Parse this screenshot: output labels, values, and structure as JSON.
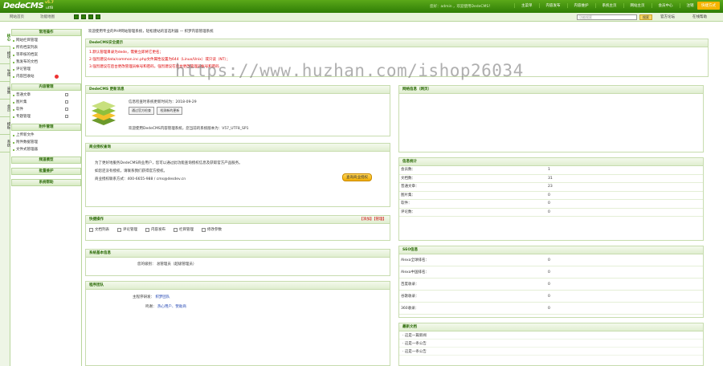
{
  "header": {
    "logo_text": "DedeCMS",
    "logo_version": "v5.7",
    "logo_sub": "utf8",
    "user_info": "您好：admin ，欢迎使用DedeCMS！",
    "nav": [
      "主菜单",
      "内容发布",
      "内容维护",
      "系统主页",
      "网站主页",
      "会员中心",
      "注销"
    ],
    "quick_button": "快捷方式"
  },
  "subbar": {
    "home_link": "网站首页",
    "map_link": "功能地图",
    "search_placeholder": "功能搜索",
    "search_button": "搜索",
    "official_forum": "官方论坛",
    "online_help": "在线帮助"
  },
  "vtabs": [
    "核心",
    "模块",
    "生成",
    "采集",
    "会员",
    "模板",
    "系统"
  ],
  "sidebar": {
    "sections": [
      {
        "title": "常用操作",
        "items": [
          "网站栏目管理",
          "所有档案列表",
          "等审核的档案",
          "我发布的文档",
          "评论管理",
          "内容回收站"
        ]
      },
      {
        "title": "内容管理",
        "items": [
          "普通文章",
          "图片集",
          "软件",
          "专题管理"
        ]
      },
      {
        "title": "附件管理",
        "items": [
          "上传新文件",
          "附件数据管理",
          "文件式管理器"
        ]
      },
      {
        "title": "频道模型",
        "items": []
      },
      {
        "title": "批量维护",
        "items": []
      },
      {
        "title": "系统帮助",
        "items": []
      }
    ]
  },
  "welcome": "欢迎使用专业的PHP网站管理系统，轻松建站的首选利器 — 织梦内容管理系统",
  "security": {
    "title": "DedeCMS安全提示",
    "lines": [
      "1.默认管理目录为dede，需要立即将它更名；",
      "2.强烈建议data/common.inc.php文件属性设置为644（Linux/Unix）或只读（NT）；",
      "3.强烈建议在后台更改管理员帐号和密码，强烈建议在后台更改管理员帐号和密码"
    ]
  },
  "version_panel": {
    "title": "DedeCMS 更新消息",
    "latest_text": "信息检查时系统更新时间为：2018-09-29",
    "btn_check": "通过官方检查",
    "btn_update": "检测新的更新",
    "version_text": "欢迎使用DedeCMS内容管理系统，您当前的系统版本为：V57_UTF8_SP1"
  },
  "business_panel": {
    "title": "商业授权查询",
    "text1": "为了更好地服务DedeCMS商业用户，您可以通过此功能查询授权信息及获取官方产品服务。",
    "text2": "如您还没有授权，请联系我们获得官方授权。",
    "text3": "商业授权联系方式：400-6655-988 / cms@desdev.cn",
    "button": "查询商业授权"
  },
  "quick_panel": {
    "title": "快捷操作",
    "right_links": "【添加】【管理】",
    "items": [
      "文档列表",
      "评论管理",
      "内容发布",
      "栏目管理",
      "修改参数"
    ]
  },
  "sysinfo_panel": {
    "title": "系统基本信息",
    "label": "您的级别：",
    "value": "总管理员（超级管理员）"
  },
  "team_panel": {
    "title": "程序团队",
    "rows": [
      {
        "label": "主程序研发：",
        "value": "织梦团队"
      },
      {
        "label": "鸣谢：",
        "value": "热心用户、赞助商"
      }
    ]
  },
  "news_panel": {
    "title": "网络信息（网页）"
  },
  "stats_panel": {
    "title": "信息统计",
    "rows": [
      {
        "k": "会员数：",
        "v": "1"
      },
      {
        "k": "文档数：",
        "v": "31"
      },
      {
        "k": "普通文章：",
        "v": "23"
      },
      {
        "k": "图片集：",
        "v": "0"
      },
      {
        "k": "软件：",
        "v": "0"
      },
      {
        "k": "评论数：",
        "v": "0"
      }
    ]
  },
  "seo_panel": {
    "title": "SEO信息",
    "rows": [
      {
        "k": "Alexa全球排名：",
        "v": "0"
      },
      {
        "k": "Alexa中国排名：",
        "v": "0"
      },
      {
        "k": "百度收录：",
        "v": "0"
      },
      {
        "k": "谷歌收录：",
        "v": "0"
      },
      {
        "k": "360收录：",
        "v": "0"
      }
    ]
  },
  "docs_panel": {
    "title": "最新文档",
    "items": [
      "· 这是一篇新闻",
      "· 这是一条公告",
      "· 这是一条公告"
    ]
  },
  "watermark": "https://www.huzhan.com/ishop26034"
}
